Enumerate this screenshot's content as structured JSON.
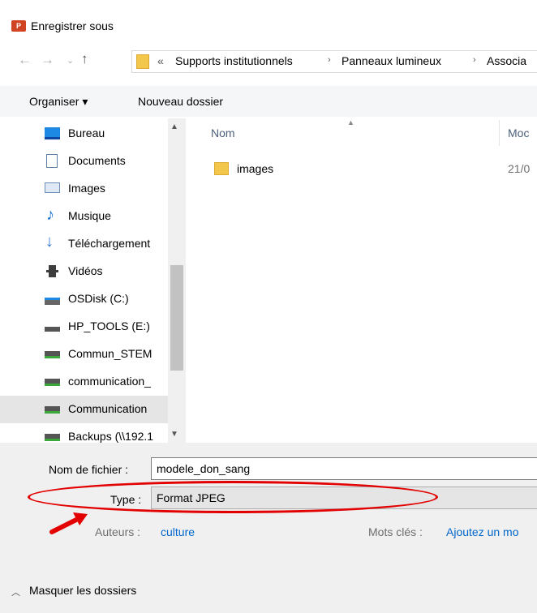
{
  "window": {
    "title": "Enregistrer sous",
    "app_icon_text": "P"
  },
  "nav": {
    "breadcrumb_prefix": "«",
    "crumbs": [
      "Supports institutionnels",
      "Panneaux lumineux",
      "Associa"
    ],
    "separator": "›"
  },
  "toolbar": {
    "organize": "Organiser ▾",
    "new_folder": "Nouveau dossier"
  },
  "sidebar": {
    "items": [
      {
        "label": "Bureau",
        "icon": "desktop-icon"
      },
      {
        "label": "Documents",
        "icon": "documents-icon"
      },
      {
        "label": "Images",
        "icon": "pictures-icon"
      },
      {
        "label": "Musique",
        "icon": "music-icon"
      },
      {
        "label": "Téléchargement",
        "icon": "download-icon"
      },
      {
        "label": "Vidéos",
        "icon": "video-icon"
      },
      {
        "label": "OSDisk (C:)",
        "icon": "drive-icon"
      },
      {
        "label": "HP_TOOLS (E:)",
        "icon": "drive-icon"
      },
      {
        "label": "Commun_STEM",
        "icon": "network-drive-icon"
      },
      {
        "label": "communication_",
        "icon": "network-drive-icon"
      },
      {
        "label": "Communication",
        "icon": "network-drive-icon"
      },
      {
        "label": "Backups (\\\\192.1",
        "icon": "network-drive-icon"
      }
    ],
    "selected_index": 10
  },
  "files": {
    "columns": {
      "name": "Nom",
      "modified": "Moc"
    },
    "rows": [
      {
        "name": "images",
        "date": "21/0"
      }
    ]
  },
  "form": {
    "filename_label": "Nom de fichier :",
    "filename_value": "modele_don_sang",
    "type_label": "Type :",
    "type_value": "Format JPEG",
    "authors_label": "Auteurs :",
    "authors_value": "culture",
    "tags_label": "Mots clés :",
    "tags_value": "Ajoutez un mo"
  },
  "footer": {
    "hide_folders": "Masquer les dossiers"
  },
  "colors": {
    "accent": "#e20000",
    "link": "#0066cc"
  }
}
